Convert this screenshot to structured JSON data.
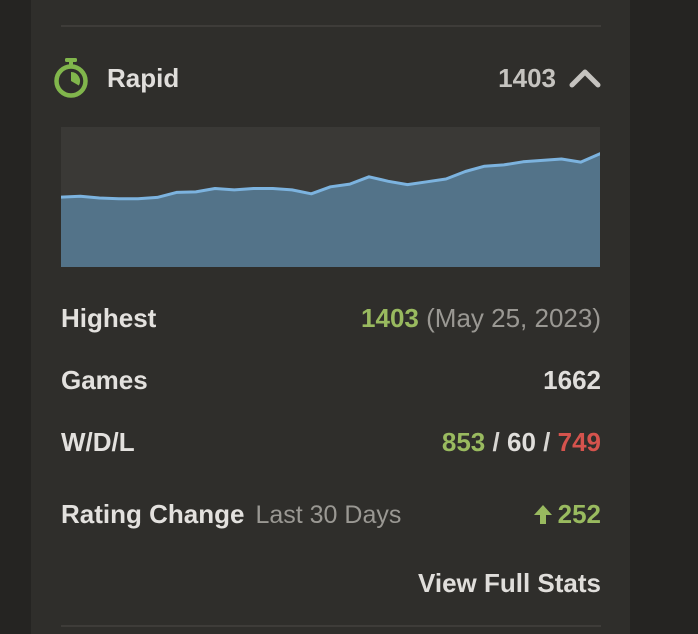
{
  "header": {
    "mode": "Rapid",
    "rating": "1403",
    "timer_icon": "stopwatch-icon",
    "collapse_icon": "chevron-up-icon"
  },
  "chart_data": {
    "type": "area",
    "title": "",
    "xlabel": "",
    "ylabel": "",
    "x": [
      1,
      2,
      3,
      4,
      5,
      6,
      7,
      8,
      9,
      10,
      11,
      12,
      13,
      14,
      15,
      16,
      17,
      18,
      19,
      20,
      21,
      22,
      23,
      24,
      25,
      26,
      27,
      28,
      29
    ],
    "values": [
      1151,
      1154,
      1148,
      1145,
      1145,
      1150,
      1168,
      1170,
      1182,
      1177,
      1182,
      1182,
      1177,
      1163,
      1188,
      1198,
      1224,
      1208,
      1196,
      1206,
      1216,
      1243,
      1262,
      1267,
      1278,
      1283,
      1288,
      1277,
      1307
    ],
    "ylim": [
      900,
      1403
    ],
    "colors": {
      "line": "#7cb3df",
      "fill": "#537389",
      "background": "#3a3936"
    }
  },
  "stats": {
    "highest_label": "Highest",
    "highest_value": "1403",
    "highest_date": "(May 25, 2023)",
    "games_label": "Games",
    "games_value": "1662",
    "wdl_label": "W/D/L",
    "wins": "853",
    "draws": "60",
    "losses": "749",
    "wdl_separator": "/",
    "change_label": "Rating Change",
    "change_period": "Last 30 Days",
    "change_value": "252",
    "change_icon": "arrow-up-icon"
  },
  "footer": {
    "link_label": "View Full Stats"
  },
  "colors": {
    "win": "#99ba5f",
    "loss": "#d5534d",
    "panel": "#2f2e2b",
    "page": "#252422"
  }
}
